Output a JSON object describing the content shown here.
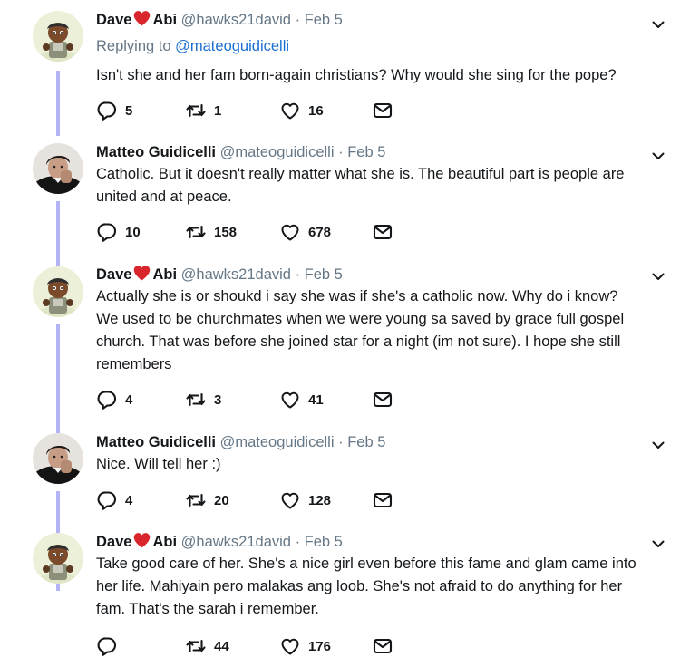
{
  "tweets": [
    {
      "avatar": "avatar-dave-icon",
      "name_a": "Dave",
      "name_b": "Abi",
      "handle": "@hawks21david",
      "sep": "·",
      "date": "Feb 5",
      "replying_prefix": "Replying to ",
      "replying_handle": "@mateoguidicelli",
      "text": "Isn't she and her fam born-again christians? Why would she sing for the pope?",
      "replies": "5",
      "retweets": "1",
      "likes": "16"
    },
    {
      "avatar": "avatar-matteo-icon",
      "name": "Matteo Guidicelli",
      "handle": "@mateoguidicelli",
      "sep": "·",
      "date": "Feb 5",
      "text": "Catholic. But it doesn't really matter what she is. The beautiful part is people are united and at peace.",
      "replies": "10",
      "retweets": "158",
      "likes": "678"
    },
    {
      "avatar": "avatar-dave-icon",
      "name_a": "Dave",
      "name_b": "Abi",
      "handle": "@hawks21david",
      "sep": "·",
      "date": "Feb 5",
      "text": "Actually she is or shoukd i say she was if she's a catholic now. Why do i know? We used to be churchmates when we were young sa saved by grace full gospel church. That was before she joined star for a night (im not sure). I hope she still remembers",
      "replies": "4",
      "retweets": "3",
      "likes": "41"
    },
    {
      "avatar": "avatar-matteo-icon",
      "name": "Matteo Guidicelli",
      "handle": "@mateoguidicelli",
      "sep": "·",
      "date": "Feb 5",
      "text": "Nice. Will tell her :)",
      "replies": "4",
      "retweets": "20",
      "likes": "128"
    },
    {
      "avatar": "avatar-dave-icon",
      "name_a": "Dave",
      "name_b": "Abi",
      "handle": "@hawks21david",
      "sep": "·",
      "date": "Feb 5",
      "text": "Take good care of her. She's a nice girl even before this fame and glam came into her life. Mahiyain pero malakas ang loob. She's not afraid to do anything for her fam. That's the sarah i remember.",
      "replies": "",
      "retweets": "44",
      "likes": "176"
    }
  ],
  "colors": {
    "thread_line": "#b3b3f5",
    "link": "#1b6fd2",
    "heart": "#e0245e",
    "meta": "#657786"
  },
  "icons": [
    "reply-icon",
    "retweet-icon",
    "like-icon",
    "dm-icon",
    "chevron-down-icon",
    "heart-emoji-icon"
  ]
}
